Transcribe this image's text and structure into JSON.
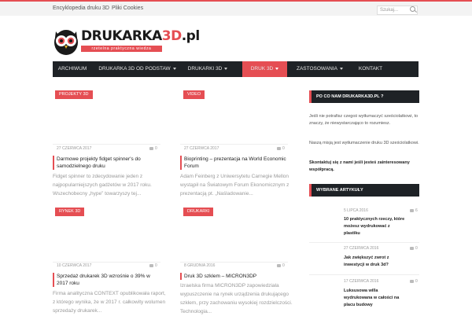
{
  "topbar": {
    "links": [
      "Encyklopedia druku 3D",
      "Pliki Cookies"
    ],
    "search_placeholder": "Szukaj..."
  },
  "logo": {
    "name_part1": "DRUKARKA",
    "name_part2": "3D",
    "name_part3": ".pl",
    "tagline": "rzetelna praktyczna wiedza"
  },
  "nav": {
    "items": [
      {
        "label": "ARCHIWUM",
        "dropdown": false,
        "active": false
      },
      {
        "label": "DRUKARKA 3D OD PODSTAW",
        "dropdown": true,
        "active": false
      },
      {
        "label": "DRUKARKI 3D",
        "dropdown": true,
        "active": false
      },
      {
        "label": "DRUK 3D",
        "dropdown": true,
        "active": true
      },
      {
        "label": "ZASTOSOWANIA",
        "dropdown": true,
        "active": false
      },
      {
        "label": "KONTAKT",
        "dropdown": false,
        "active": false
      }
    ]
  },
  "posts": [
    {
      "category": "PROJEKTY 3D",
      "date": "27 CZERWCA 2017",
      "comments": "0",
      "title": "Darmowe projekty fidget spinner's do samodzielnego druku",
      "excerpt": "Fidget spinner to zdecydowanie jeden z najpopularniejszych gadżetów w 2017 roku. Wszechobecny „hype” towarzyszy tej..."
    },
    {
      "category": "VIDEO",
      "date": "27 CZERWCA 2017",
      "comments": "0",
      "title": "Bioprinting – prezentacja na World Economic Forum",
      "excerpt": "Adam Feinberg z Uniwersytetu Carnegie Mellon wystąpił na Światowym Forum Ekonomicznym z prezentacją pt. „Naśladowanie..."
    },
    {
      "category": "RYNEK 3D",
      "date": "10 CZERWCA 2017",
      "comments": "0",
      "title": "Sprzedaż drukarek 3D wzrośnie o 39% w 2017 roku",
      "excerpt": "Firma analityczna CONTEXT opublikowała raport, z którego wynika, że w 2017 r. całkowity wolumen sprzedaży drukarek..."
    },
    {
      "category": "DRUKARKI",
      "date": "8 GRUDNIA 2016",
      "comments": "0",
      "title": "Druk 3D szklem – MICRON3DP",
      "excerpt": "Izraelska firma MICRON3DP zapowiedziała wypuszczenie na rynek urządzenia drukującego szkłem, przy zachowaniu wysokiej rozdzielczości. Technologia..."
    }
  ],
  "sidebar": {
    "about_heading": "PO CO NAM DRUKARKA3D.PL ?",
    "about_p1": "Jeśli nie potrafisz czegoś wytłumaczyć sześciolatkowi, to znaczy, że niewystarczająco to rozumiesz.",
    "about_p2": "Naszą misją jest wytłumaczenie druku 3D sześciolatkowi.",
    "about_p3": "Skontaktuj się z nami jeśli jesteś zainteresowany współpracą.",
    "featured_heading": "WYBRANE ARTYKUŁY",
    "featured": [
      {
        "date": "5 LIPCA 2016",
        "comments": "6",
        "title": "10 praktycznych rzeczy, które możesz wydrukować z plastiku"
      },
      {
        "date": "27 CZERWCA 2016",
        "comments": "0",
        "title": "Jak zwiększyć zwrot z inwestycji w druk 3d?"
      },
      {
        "date": "17 CZERWCA 2016",
        "comments": "0",
        "title": "Luksusowa willa wydrukowana w całości na placu budowy"
      }
    ]
  },
  "colors": {
    "accent": "#e54e53",
    "nav_bg": "#1e2226"
  }
}
